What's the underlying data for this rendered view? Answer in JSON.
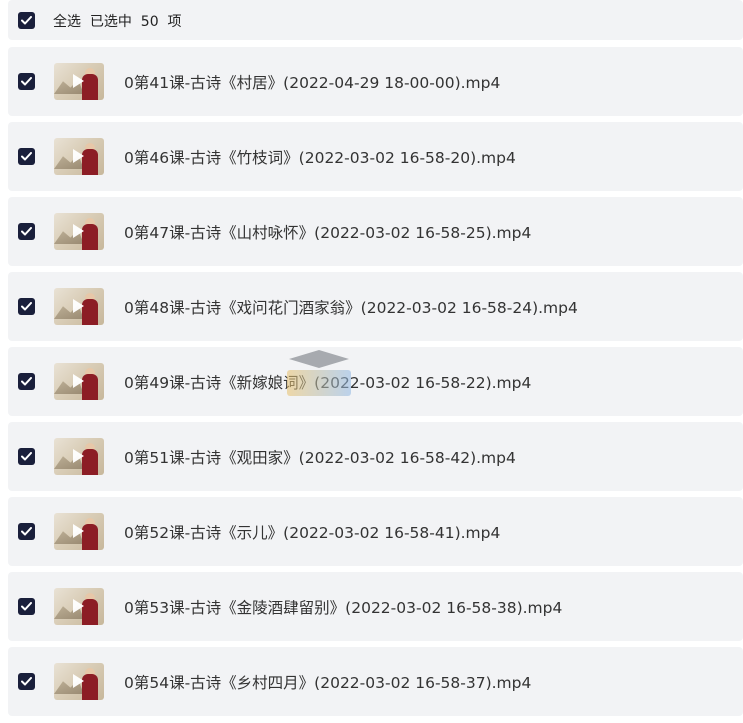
{
  "header": {
    "select_all_label": "全选  已选中  50  项"
  },
  "items": [
    {
      "name": "0第41课-古诗《村居》(2022-04-29 18-00-00).mp4",
      "checked": true
    },
    {
      "name": "0第46课-古诗《竹枝词》(2022-03-02 16-58-20).mp4",
      "checked": true
    },
    {
      "name": "0第47课-古诗《山村咏怀》(2022-03-02 16-58-25).mp4",
      "checked": true
    },
    {
      "name": "0第48课-古诗《戏问花门酒家翁》(2022-03-02 16-58-24).mp4",
      "checked": true
    },
    {
      "name": "0第49课-古诗《新嫁娘词》(2022-03-02 16-58-22).mp4",
      "checked": true
    },
    {
      "name": "0第51课-古诗《观田家》(2022-03-02 16-58-42).mp4",
      "checked": true
    },
    {
      "name": "0第52课-古诗《示儿》(2022-03-02 16-58-41).mp4",
      "checked": true
    },
    {
      "name": "0第53课-古诗《金陵酒肆留别》(2022-03-02 16-58-38).mp4",
      "checked": true
    },
    {
      "name": "0第54课-古诗《乡村四月》(2022-03-02 16-58-37).mp4",
      "checked": true
    }
  ],
  "colors": {
    "row_bg": "#f2f3f5",
    "checkbox": "#1a1f3b"
  }
}
